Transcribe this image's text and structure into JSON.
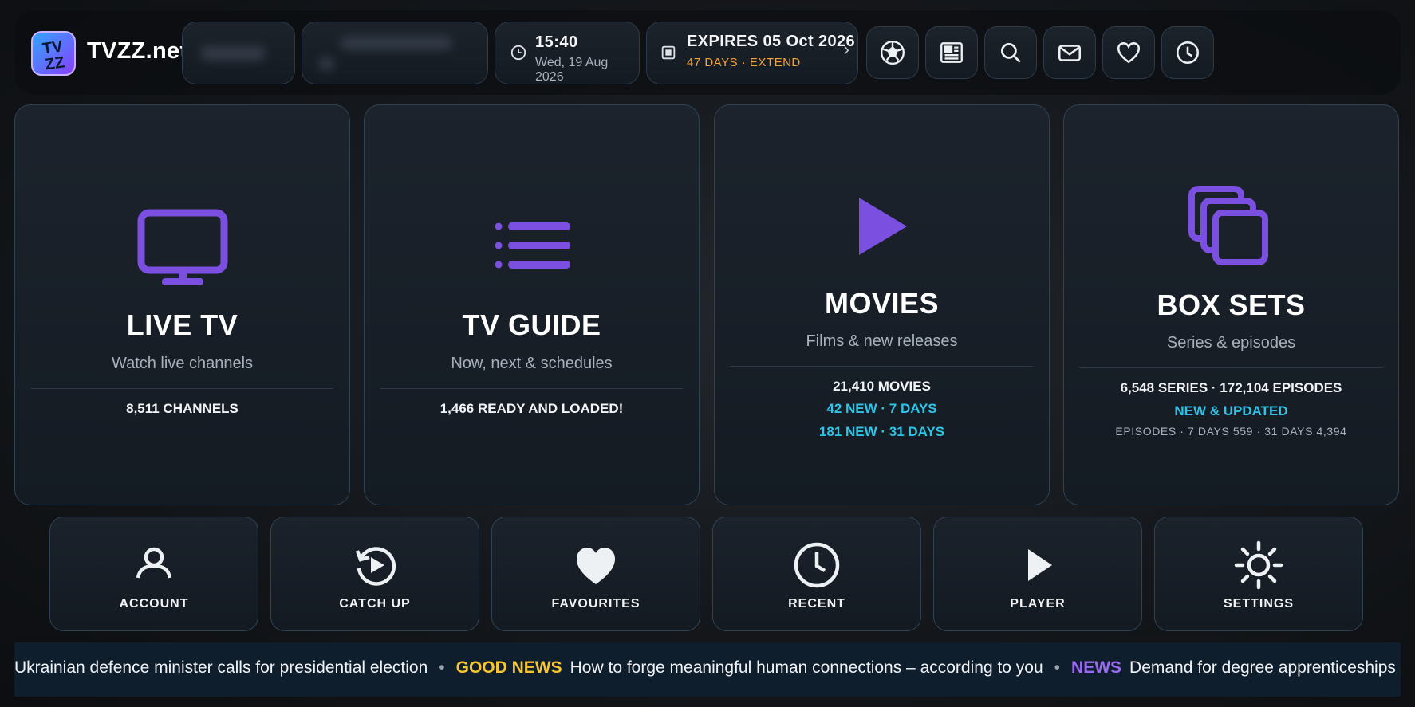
{
  "brand": {
    "name": "TVZZ.net",
    "logo_text": "TVZZ"
  },
  "clock": {
    "time": "15:40",
    "date": "Wed, 19 Aug 2026"
  },
  "subscription": {
    "expires": "EXPIRES 05 Oct 2026",
    "days_left": "47 DAYS · EXTEND"
  },
  "toolbar_icons": [
    "soccer-ball-icon",
    "news-icon",
    "search-icon",
    "mail-icon",
    "heart-icon",
    "clock-icon"
  ],
  "cards": {
    "live_tv": {
      "title": "LIVE TV",
      "subtitle": "Watch live channels",
      "stat": "8,511  CHANNELS"
    },
    "tv_guide": {
      "title": "TV GUIDE",
      "subtitle": "Now, next & schedules",
      "stat": "1,466 READY AND LOADED!"
    },
    "movies": {
      "title": "MOVIES",
      "subtitle": "Films & new releases",
      "stat": "21,410  MOVIES",
      "new7": "42  NEW · 7 DAYS",
      "new31": "181  NEW · 31 DAYS"
    },
    "box_sets": {
      "title": "BOX SETS",
      "subtitle": "Series & episodes",
      "stat": "6,548 SERIES · 172,104 EPISODES",
      "new_label": "NEW & UPDATED",
      "episodes": "EPISODES · 7 DAYS 559 · 31 DAYS 4,394"
    }
  },
  "tiles": {
    "account": "ACCOUNT",
    "catch_up": "CATCH UP",
    "favourites": "FAVOURITES",
    "recent": "RECENT",
    "player": "PLAYER",
    "settings": "SETTINGS"
  },
  "ticker": {
    "item1": "Ukrainian defence minister calls for presidential election",
    "tag2": "GOOD NEWS",
    "item2": "How to forge meaningful human connections – according to you",
    "tag3": "NEWS",
    "item3": "Demand for degree apprenticeships is"
  },
  "colors": {
    "accent_purple": "#7b4fe0",
    "cyan": "#2ec4e8",
    "orange": "#f0a33a",
    "yellow": "#f7c630"
  }
}
